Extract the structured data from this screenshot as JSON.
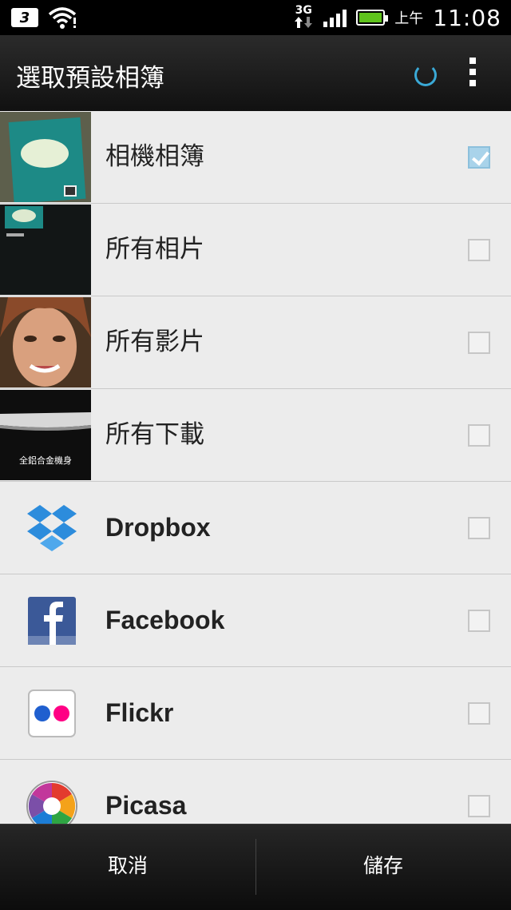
{
  "status_bar": {
    "carrier_badge": "3",
    "network": "3G",
    "ampm": "上午",
    "time": "11:08"
  },
  "action_bar": {
    "title": "選取預設相簿"
  },
  "albums": [
    {
      "label": "相機相簿",
      "checked": true,
      "thumb": "camera-album-thumbnail"
    },
    {
      "label": "所有相片",
      "checked": false,
      "thumb": "all-photos-thumbnail"
    },
    {
      "label": "所有影片",
      "checked": false,
      "thumb": "all-videos-thumbnail"
    },
    {
      "label": "所有下載",
      "checked": false,
      "thumb": "all-downloads-thumbnail",
      "thumb_caption": "全鋁合金機身"
    },
    {
      "label": "Dropbox",
      "checked": false,
      "icon": "dropbox-icon"
    },
    {
      "label": "Facebook",
      "checked": false,
      "icon": "facebook-icon"
    },
    {
      "label": "Flickr",
      "checked": false,
      "icon": "flickr-icon"
    },
    {
      "label": "Picasa",
      "checked": false,
      "icon": "picasa-icon"
    }
  ],
  "footer": {
    "cancel_label": "取消",
    "save_label": "儲存"
  },
  "colors": {
    "accent": "#3aa9d6",
    "checked_box": "#a9d3ea",
    "battery": "#5fc31c"
  }
}
